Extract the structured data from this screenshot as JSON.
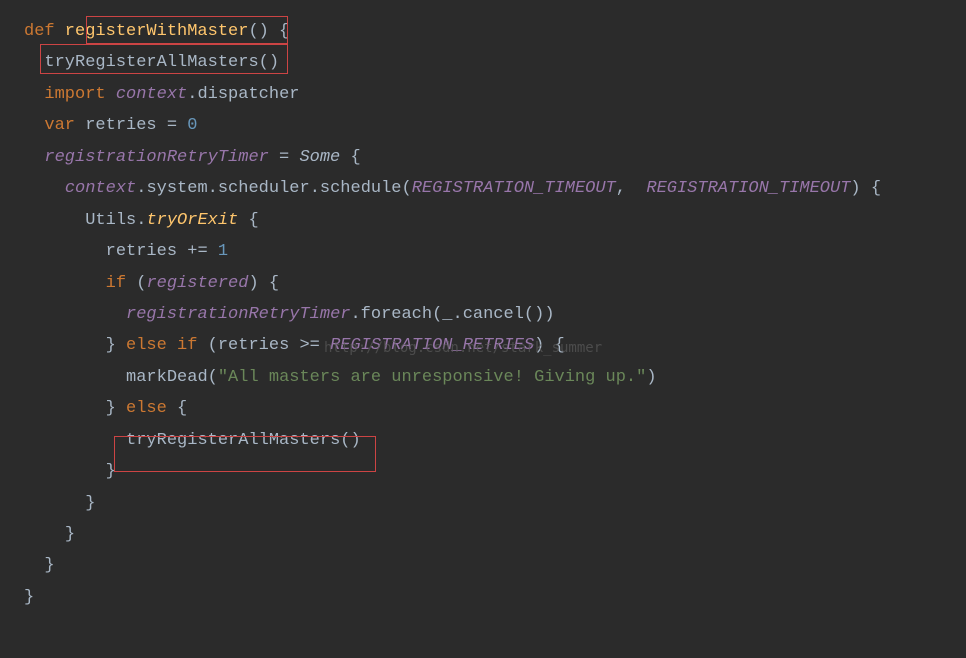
{
  "code": {
    "line1": {
      "def": "def",
      "funcName": " registerWithMaster",
      "parens": "()",
      "brace": " {"
    },
    "line2": {
      "call": "tryRegisterAllMasters",
      "parens": "()"
    },
    "line3": {
      "import": "import",
      "context": " context",
      "dot": ".",
      "dispatcher": "dispatcher"
    },
    "line4": {
      "var": "var",
      "retries": " retries ",
      "eq": "=",
      "zero": " 0"
    },
    "line5": {
      "timer": "registrationRetryTimer",
      "eq": " = ",
      "some": "Some",
      "brace": " {"
    },
    "line6": {
      "context": "context",
      "dot1": ".",
      "system": "system",
      "dot2": ".",
      "scheduler": "scheduler",
      "dot3": ".",
      "schedule": "schedule",
      "open": "(",
      "arg1": "REGISTRATION_TIMEOUT",
      "comma": ",  ",
      "arg2": "REGISTRATION_TIMEOUT",
      "close": ")",
      "brace": " {"
    },
    "line7": {
      "utils": "Utils",
      "dot": ".",
      "tryOrExit": "tryOrExit",
      "brace": " {"
    },
    "line8": {
      "retries": "retries ",
      "op": "+=",
      "one": " 1"
    },
    "line9": {
      "if": "if",
      "open": " (",
      "registered": "registered",
      "close": ")",
      "brace": " {"
    },
    "line10": {
      "timer": "registrationRetryTimer",
      "dot": ".",
      "foreach": "foreach",
      "open": "(",
      "underscore": "_",
      "dot2": ".",
      "cancel": "cancel",
      "parens": "()",
      "close": ")"
    },
    "line11": {
      "closebrace": "}",
      "else": " else if",
      "open": " (",
      "retries": "retries ",
      "op": ">=",
      "const": " REGISTRATION_RETRIES",
      "close": ")",
      "brace": " {"
    },
    "line12": {
      "markDead": "markDead",
      "open": "(",
      "str": "\"All masters are unresponsive! Giving up.\"",
      "close": ")"
    },
    "line13": {
      "closebrace": "}",
      "else": " else",
      "brace": " {"
    },
    "line14": {
      "call": "tryRegisterAllMasters",
      "parens": "()"
    },
    "line15": {
      "brace": "}"
    },
    "line16": {
      "brace": "}"
    },
    "line17": {
      "brace": "}"
    },
    "line18": {
      "brace": "}"
    },
    "line19": {
      "brace": "}"
    }
  },
  "watermark": "http://blog.csdn.net/stark_summer",
  "indents": {
    "i1": "  ",
    "i2": "    ",
    "i3": "      ",
    "i4": "        ",
    "i5": "          ",
    "i6": "            "
  }
}
